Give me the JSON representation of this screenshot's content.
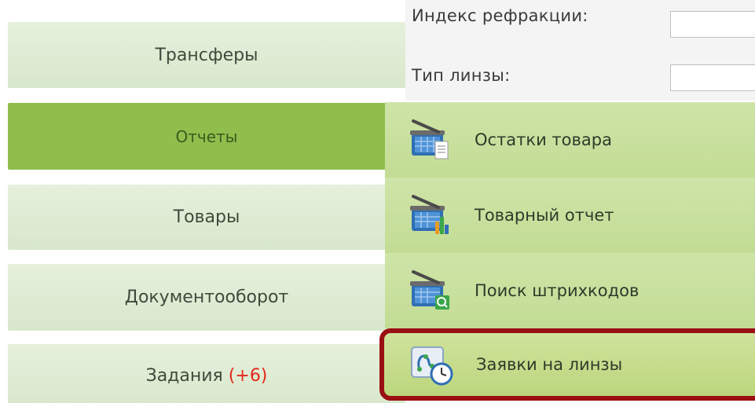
{
  "form": {
    "refraction_label": "Индекс рефракции:",
    "lens_type_label": "Тип линзы:",
    "refraction_value": "",
    "lens_type_value": ""
  },
  "nav": {
    "items": [
      {
        "label": "Трансферы"
      },
      {
        "label": "Отчеты",
        "active": true
      },
      {
        "label": "Товары"
      },
      {
        "label": "Документооборот"
      },
      {
        "label": "Задания",
        "badge": "(+6)"
      }
    ]
  },
  "reports_menu": {
    "items": [
      {
        "label": "Остатки товара",
        "icon": "basket-document-icon"
      },
      {
        "label": "Товарный отчет",
        "icon": "basket-chart-icon"
      },
      {
        "label": "Поиск штрихкодов",
        "icon": "basket-search-icon"
      },
      {
        "label": "Заявки на линзы",
        "icon": "lens-order-clock-icon",
        "highlighted": true
      }
    ]
  },
  "colors": {
    "active_nav": "#8fbe4d",
    "nav_bg": "#dde9d2",
    "submenu_bg": "#c8df9e",
    "highlight_border": "#9a0f12",
    "badge": "#e0281b"
  }
}
